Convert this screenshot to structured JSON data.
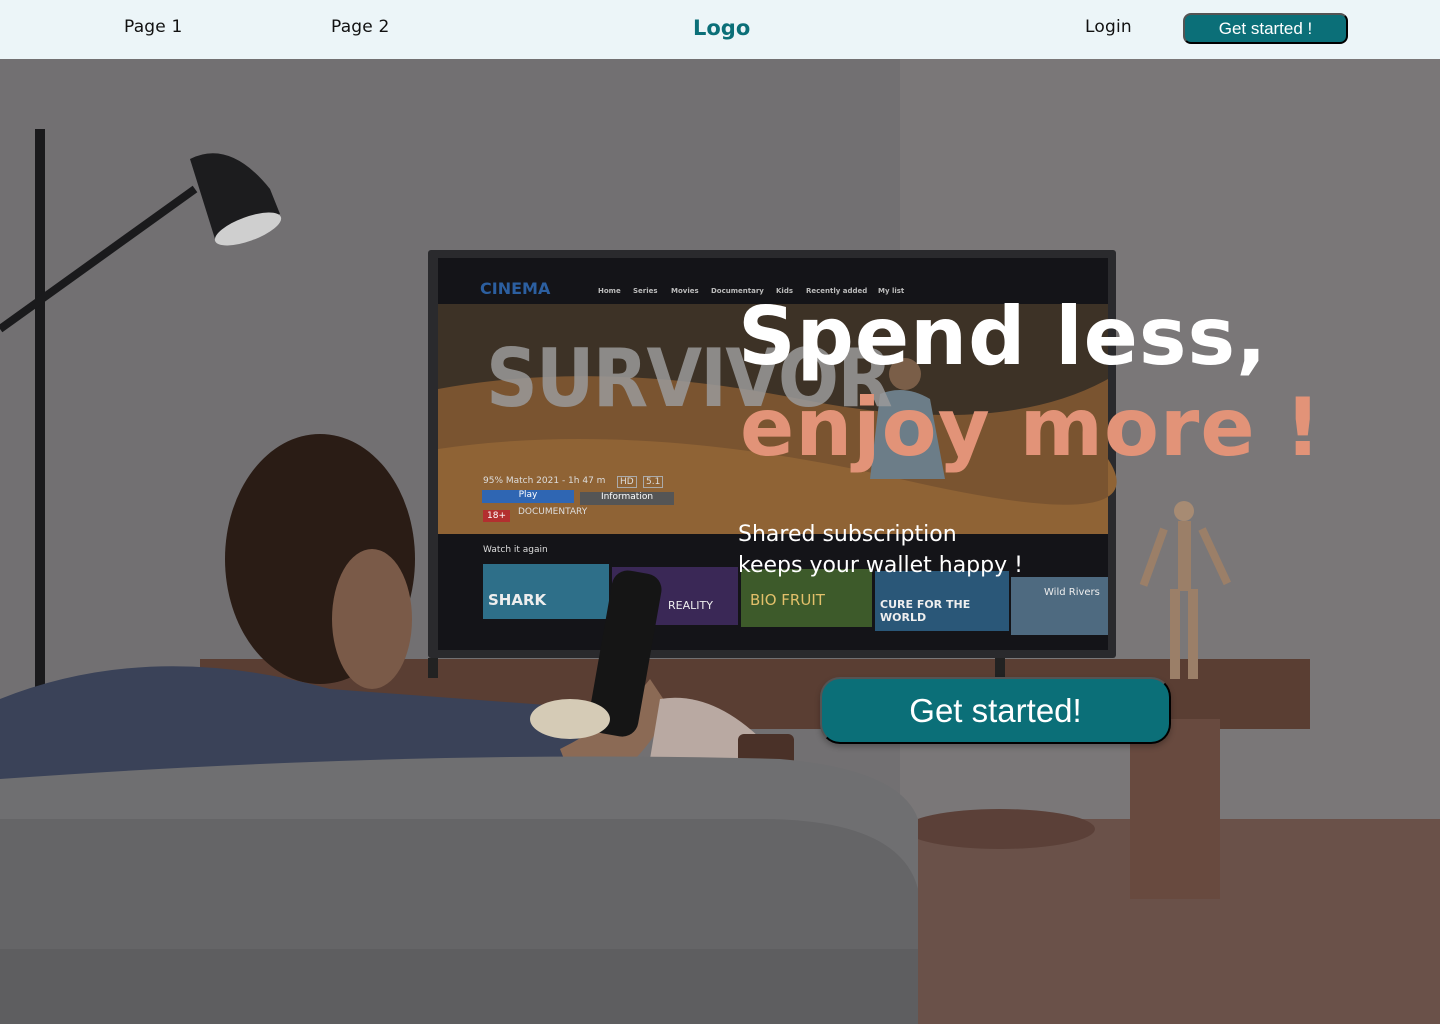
{
  "nav": {
    "page1": "Page 1",
    "page2": "Page 2",
    "logo": "Logo",
    "login": "Login",
    "cta": "Get started !"
  },
  "hero": {
    "headline_line1": "Spend less,",
    "headline_line2": "enjoy more !",
    "subtitle_line1": "Shared subscription",
    "subtitle_line2": "keeps your wallet happy !",
    "cta": "Get started!"
  },
  "tv_screen": {
    "brand": "CINEMA",
    "menu": [
      "Home",
      "Series",
      "Movies",
      "Documentary",
      "Kids",
      "Recently added",
      "My list"
    ],
    "title": "SURVIVOR",
    "meta": "95% Match 2021 - 1h 47 m",
    "badge_hd": "HD",
    "badge_51": "5.1",
    "play": "Play",
    "info": "Information",
    "rating": "18+",
    "genre": "DOCUMENTARY",
    "row_title": "Watch it again",
    "thumbs": [
      "SHARK",
      "REALITY",
      "BIO FRUIT",
      "CURE FOR THE WORLD",
      "Wild Rivers"
    ]
  },
  "colors": {
    "accent": "#0b6f78",
    "highlight": "#e29378",
    "nav_bg": "#ecf5f8"
  }
}
